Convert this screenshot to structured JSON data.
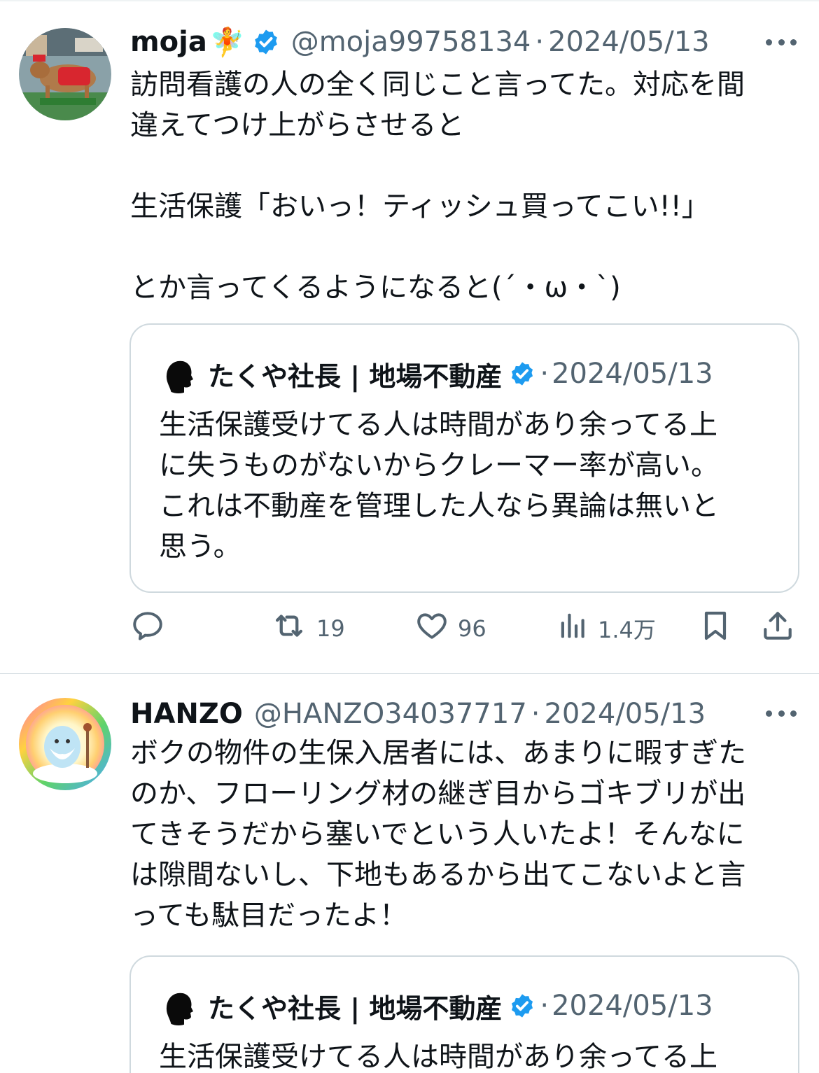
{
  "tweets": [
    {
      "display_name": "moja",
      "emoji": "🧚",
      "handle": "@moja99758134",
      "separator": "·",
      "date": "2024/05/13",
      "text": "訪問看護の人の全く同じこと言ってた。対応を間\n違えてつけ上がらさせると\n\n生活保護「おいっ！ティッシュ買ってこい!!」\n\nとか言ってくるようになると(´・ω・`)",
      "quote": {
        "display_name": "たくや社長 | 地場不動産",
        "separator": "·",
        "date": "2024/05/13",
        "text": "生活保護受けてる人は時間があり余ってる上\nに失うものがないからクレーマー率が高い。\nこれは不動産を管理した人なら異論は無いと\n思う。"
      },
      "actions": {
        "reply_icon": "reply-icon",
        "retweet_icon": "retweet-icon",
        "retweets": "19",
        "like_icon": "heart-icon",
        "likes": "96",
        "views_icon": "views-icon",
        "views": "1.4万",
        "bookmark_icon": "bookmark-icon",
        "share_icon": "share-icon"
      }
    },
    {
      "display_name": "HANZO",
      "handle": "@HANZO34037717",
      "separator": "·",
      "date": "2024/05/13",
      "text": "ボクの物件の生保入居者には、あまりに暇すぎた\nのか、フローリング材の継ぎ目からゴキブリが出\nてきそうだから塞いでという人いたよ！そんなに\nは隙間ないし、下地もあるから出てこないよと言\nっても駄目だったよ！",
      "quote": {
        "display_name": "たくや社長 | 地場不動産",
        "separator": "·",
        "date": "2024/05/13",
        "text": "生活保護受けてる人は時間があり余ってる上"
      }
    }
  ],
  "colors": {
    "text": "#0f1419",
    "secondary": "#536471",
    "verified": "#1d9bf0",
    "border": "#cfd9de"
  }
}
